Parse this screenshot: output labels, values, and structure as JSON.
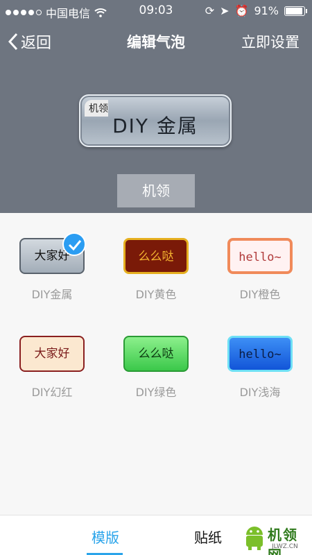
{
  "status_bar": {
    "carrier": "中国电信",
    "time": "09:03",
    "battery": "91%"
  },
  "nav": {
    "back_label": "返回",
    "title": "编辑气泡",
    "action_label": "立即设置"
  },
  "preview": {
    "nickname": "机领",
    "text": "DIY 金属"
  },
  "nickname_button": "机领",
  "templates": [
    {
      "preview_text": "大家好",
      "label": "DIY金属",
      "selected": true
    },
    {
      "preview_text": "么么哒",
      "label": "DIY黄色"
    },
    {
      "preview_text": "hello~",
      "label": "DIY橙色"
    },
    {
      "preview_text": "大家好",
      "label": "DIY幻红"
    },
    {
      "preview_text": "么么哒",
      "label": "DIY绿色"
    },
    {
      "preview_text": "hello~",
      "label": "DIY浅海"
    }
  ],
  "tabs": {
    "model": "模版",
    "sticker": "贴纸"
  },
  "watermark": {
    "logo_text": "机领网",
    "url": "JLWZ.CN"
  },
  "colors": {
    "accent": "#2aa4ea",
    "header_bg": "#6e7580"
  }
}
